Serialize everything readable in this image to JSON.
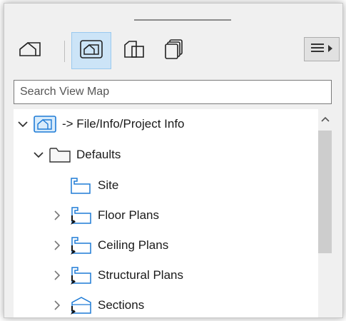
{
  "toolbar": {
    "buttons": [
      {
        "name": "project-map-icon"
      },
      {
        "name": "view-map-icon",
        "active": true
      },
      {
        "name": "layout-book-icon"
      },
      {
        "name": "publisher-sets-icon"
      }
    ],
    "menu_icon": "hamburger-icon"
  },
  "search": {
    "placeholder": "Search View Map"
  },
  "tree": {
    "items": [
      {
        "label": "-> File/Info/Project Info",
        "icon": "view-map-root-icon",
        "expanded": true
      },
      {
        "label": "Defaults",
        "icon": "folder-icon",
        "expanded": true
      },
      {
        "label": "Site",
        "icon": "floor-plan-view-icon"
      },
      {
        "label": "Floor Plans",
        "icon": "floor-plan-clone-icon",
        "expandable": true
      },
      {
        "label": "Ceiling Plans",
        "icon": "floor-plan-clone-icon",
        "expandable": true
      },
      {
        "label": "Structural Plans",
        "icon": "floor-plan-clone-icon",
        "expandable": true
      },
      {
        "label": "Sections",
        "icon": "section-clone-icon",
        "expandable": true
      }
    ]
  },
  "colors": {
    "accent": "#1e7bd6",
    "active_bg": "#cce4f7",
    "active_border": "#99c9ef",
    "panel_bg": "#f0f0f0"
  }
}
